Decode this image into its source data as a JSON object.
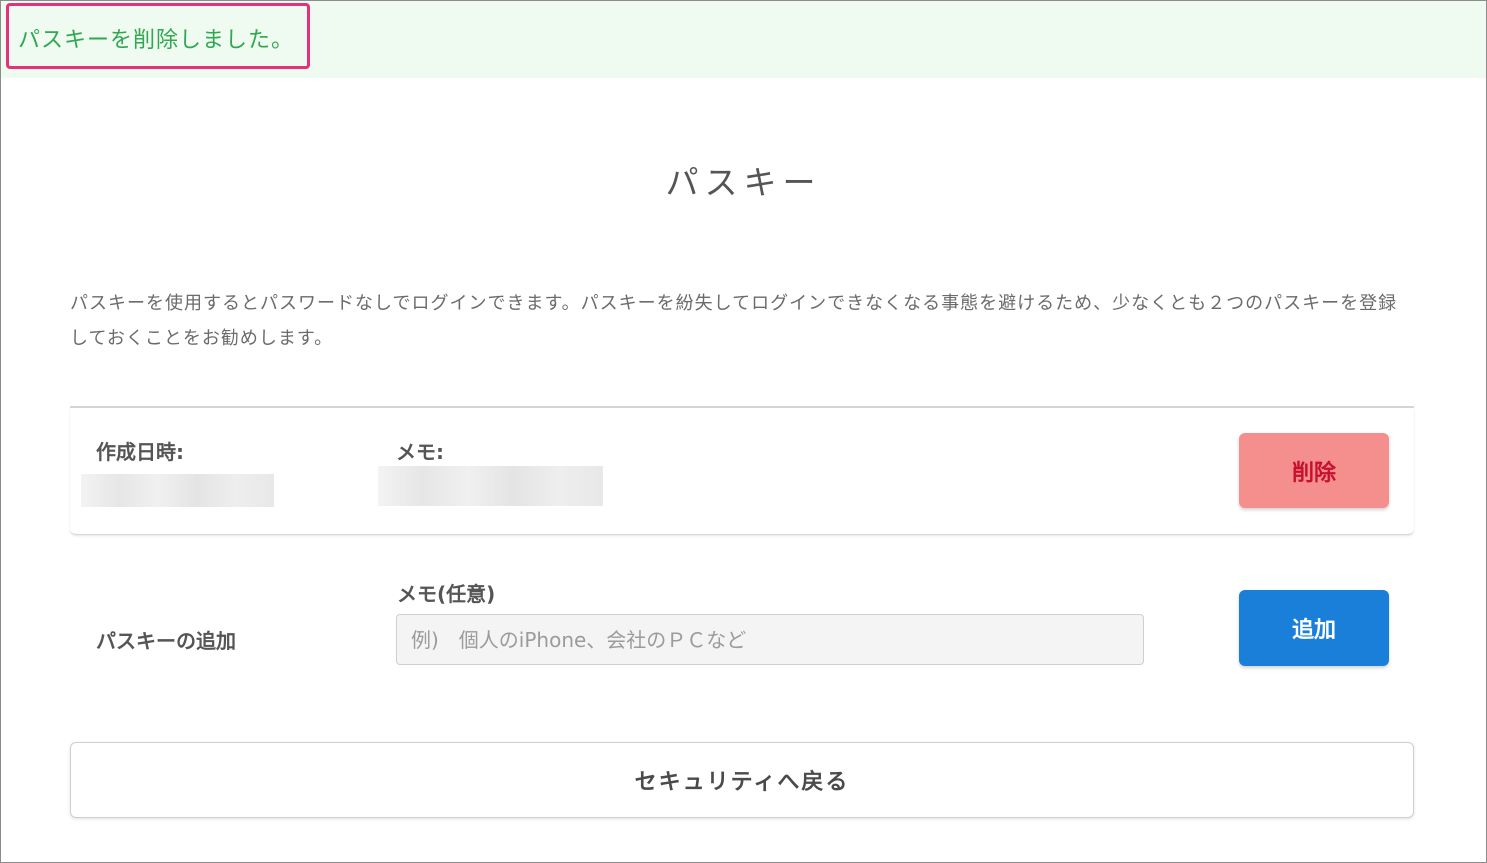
{
  "flash": {
    "message": "パスキーを削除しました。"
  },
  "page": {
    "title": "パスキー",
    "description": "パスキーを使用するとパスワードなしでログインできます。パスキーを紛失してログインできなくなる事態を避けるため、少なくとも２つのパスキーを登録しておくことをお勧めします。"
  },
  "passkey_list": {
    "created_label": "作成日時:",
    "memo_label": "メモ:",
    "delete_label": "削除"
  },
  "add_passkey": {
    "section_label": "パスキーの追加",
    "memo_label": "メモ(任意)",
    "memo_placeholder": "例)　個人のiPhone、会社のＰＣなど",
    "add_label": "追加"
  },
  "navigation": {
    "back_label": "セキュリティへ戻る"
  },
  "colors": {
    "flash_background": "#effaf1",
    "flash_text": "#2fa84f",
    "highlight_border": "#e6317a",
    "delete_button": "#f58f8d",
    "delete_text": "#c8102e",
    "add_button": "#1a7fd9"
  }
}
